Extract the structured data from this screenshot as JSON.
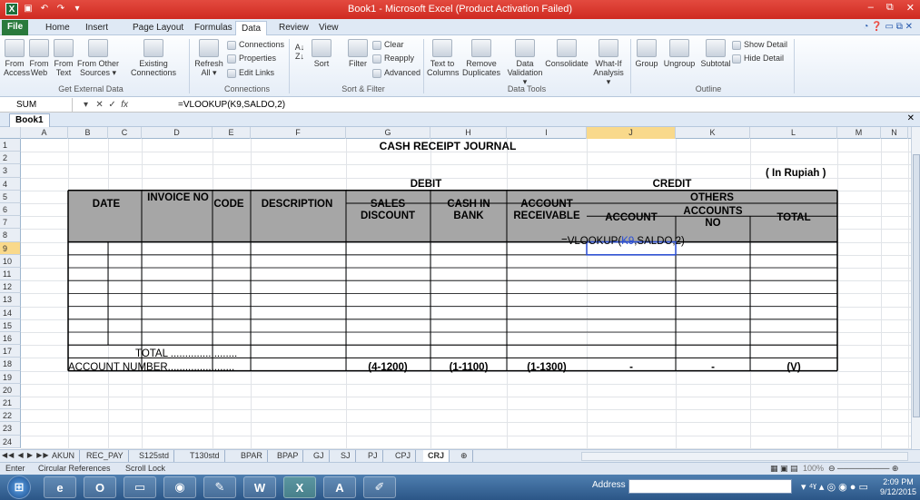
{
  "window": {
    "title": "Book1 - Microsoft Excel (Product Activation Failed)",
    "controls": [
      "–",
      "⧉",
      "✕"
    ]
  },
  "ribbon_tabs": [
    "File",
    "Home",
    "Insert",
    "Page Layout",
    "Formulas",
    "Data",
    "Review",
    "View"
  ],
  "active_tab": "Data",
  "ribbon": {
    "get_external_data": {
      "label": "Get External Data",
      "buttons": [
        {
          "line1": "From",
          "line2": "Access"
        },
        {
          "line1": "From",
          "line2": "Web"
        },
        {
          "line1": "From",
          "line2": "Text"
        },
        {
          "line1": "From Other",
          "line2": "Sources ▾"
        },
        {
          "line1": "Existing",
          "line2": "Connections"
        }
      ]
    },
    "connections": {
      "label": "Connections",
      "refresh": {
        "line1": "Refresh",
        "line2": "All ▾"
      },
      "items": [
        "Connections",
        "Properties",
        "Edit Links"
      ]
    },
    "sort_filter": {
      "label": "Sort & Filter",
      "sort": "Sort",
      "filter": "Filter",
      "items": [
        "Clear",
        "Reapply",
        "Advanced"
      ]
    },
    "data_tools": {
      "label": "Data Tools",
      "buttons": [
        {
          "line1": "Text to",
          "line2": "Columns"
        },
        {
          "line1": "Remove",
          "line2": "Duplicates"
        },
        {
          "line1": "Data",
          "line2": "Validation ▾"
        },
        {
          "line1": "Consolidate",
          "line2": ""
        },
        {
          "line1": "What-If",
          "line2": "Analysis ▾"
        }
      ]
    },
    "outline": {
      "label": "Outline",
      "buttons": [
        "Group",
        "Ungroup",
        "Subtotal"
      ],
      "items": [
        "Show Detail",
        "Hide Detail"
      ]
    }
  },
  "formula_bar": {
    "name_box": "SUM",
    "formula": "=VLOOKUP(K9,SALDO,2)"
  },
  "workbook_tab": "Book1",
  "columns": [
    "A",
    "B",
    "C",
    "D",
    "E",
    "F",
    "G",
    "H",
    "I",
    "J",
    "K",
    "L",
    "M",
    "N"
  ],
  "selected_column": "J",
  "rows": [
    "1",
    "2",
    "3",
    "4",
    "5",
    "6",
    "7",
    "8",
    "9",
    "10",
    "11",
    "12",
    "13",
    "14",
    "15",
    "16",
    "17",
    "18",
    "19",
    "20",
    "21",
    "22",
    "23",
    "24"
  ],
  "selected_row": "9",
  "sheet": {
    "title": "CASH RECEIPT JOURNAL",
    "unit_note": "( In Rupiah )",
    "headers": {
      "date": "DATE",
      "invoice": "INVOICE NO",
      "code": "CODE",
      "description": "DESCRIPTION",
      "debit": "DEBIT",
      "sales_discount": "SALES DISCOUNT",
      "cash_in_bank": "CASH IN BANK",
      "credit": "CREDIT",
      "account_receivable": "ACCOUNT RECEIVABLE",
      "others": "OTHERS",
      "account": "ACCOUNT",
      "accounts_no": "ACCOUNTS NO",
      "total": "TOTAL"
    },
    "edit_formula": "=VLOOKUP(K9,SALDO,2)",
    "edit_formula_parts": [
      "=VLOOKUP(",
      "K9",
      ",SALDO,2)"
    ],
    "total_label": "TOTAL .......................",
    "account_number_label": "ACCOUNT NUMBER.......................",
    "account_numbers": {
      "sales_discount": "(4-1200)",
      "cash_in_bank": "(1-1100)",
      "account_receivable": "(1-1300)",
      "account": "-",
      "accounts_no": "-",
      "total": "(V)"
    }
  },
  "sheet_tabs": [
    "AKUN",
    "REC_PAY",
    "S125std",
    "T130std",
    "BPAR",
    "BPAP",
    "GJ",
    "SJ",
    "PJ",
    "CPJ",
    "CRJ"
  ],
  "active_sheet": "CRJ",
  "status": {
    "mode": "Enter",
    "circular": "Circular References",
    "scroll_lock": "Scroll Lock",
    "zoom": "100%"
  },
  "taskbar": {
    "address_label": "Address",
    "time": "2:09 PM",
    "date": "9/12/2015"
  },
  "colors": {
    "title_bar": "#d8372c",
    "header_fill": "#a6a6a6",
    "selection": "#f9d98b"
  }
}
